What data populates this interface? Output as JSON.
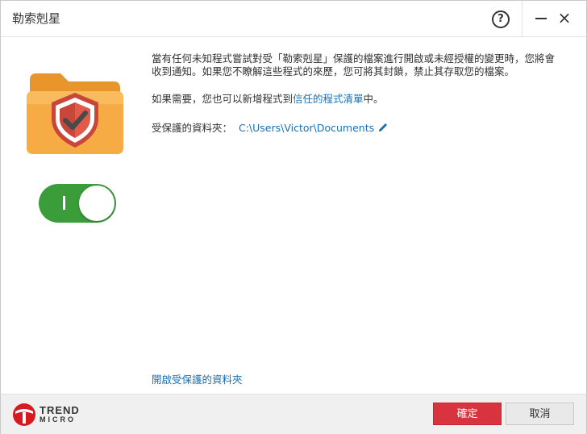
{
  "window": {
    "title": "勒索剋星"
  },
  "titlebar": {
    "help_label": "?",
    "close_label": "×"
  },
  "toggle": {
    "state": "on",
    "color": "#3a9d3a"
  },
  "content": {
    "paragraph1": "當有任何未知程式嘗試對受「勒索剋星」保護的檔案進行開啟或未經授權的變更時，您將會收到通知。如果您不瞭解這些程式的來歷，您可將其封鎖，禁止其存取您的檔案。",
    "paragraph2_prefix": "如果需要，您也可以新增程式到",
    "trusted_list_link": "信任的程式清單",
    "paragraph2_suffix": "中。",
    "protected_folder_label": "受保護的資料夾：",
    "protected_folder_path": "C:\\Users\\Victor\\Documents"
  },
  "links": {
    "open_protected_folders": "開啟受保護的資料夾"
  },
  "footer": {
    "logo_line1": "TREND",
    "logo_line2": "MICRO",
    "ok_label": "確定",
    "cancel_label": "取消"
  },
  "colors": {
    "link": "#1a6fb3",
    "ok_button": "#d9333f",
    "folder": "#f5a53a",
    "shield": "#c8473a"
  },
  "icons": {
    "folder": "folder-shield-check-icon",
    "edit": "pencil-icon",
    "help": "question-circle-icon",
    "minimize": "minimize-icon",
    "close": "close-icon",
    "logo": "trend-micro-logo"
  }
}
